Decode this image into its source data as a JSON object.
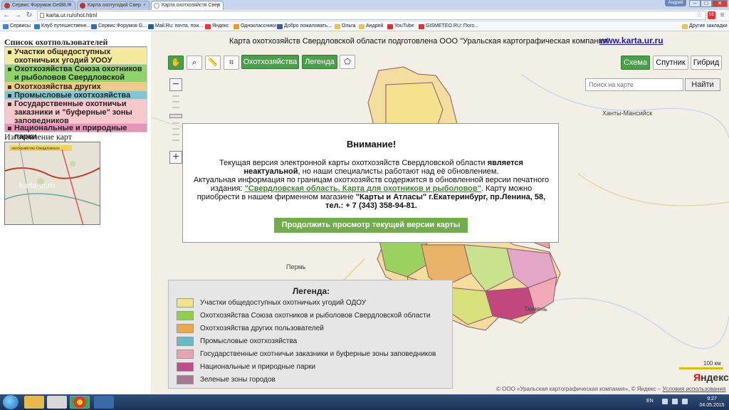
{
  "browser": {
    "tabs": [
      {
        "label": "Сервис Форумов Get88.R"
      },
      {
        "label": "Карта охотугодий Свер"
      },
      {
        "label": "Карта охотхозяйств Свер"
      }
    ],
    "user_badge": "Андрей",
    "url": "karta.ur.ru/ohot.html",
    "bookmarks": [
      {
        "label": "Сервисы",
        "color": "#4a7fd0"
      },
      {
        "label": "Клуб путешественн...",
        "color": "#2a7fd0"
      },
      {
        "label": "Сервис Форумов G...",
        "color": "#3a6ab0"
      },
      {
        "label": "Mail.Ru: почта, пои...",
        "color": "#1f5fa0"
      },
      {
        "label": "Яндекс",
        "color": "#e33"
      },
      {
        "label": "Одноклассники",
        "color": "#f7931e"
      },
      {
        "label": "Добро пожаловать...",
        "color": "#3b5998"
      },
      {
        "label": "Ольга",
        "color": "#e8c35a"
      },
      {
        "label": "Андрей",
        "color": "#e8c35a"
      },
      {
        "label": "YouTube",
        "color": "#e52d27"
      },
      {
        "label": "GISMETEO.RU: Пого...",
        "color": "#d33"
      }
    ],
    "other_bookmarks": "Другие закладки"
  },
  "sidebar": {
    "title": "Список охотпользователей",
    "categories": [
      {
        "label": "Участки общедоступных охотничьих угодий УООУ",
        "color": "#f4eb9e"
      },
      {
        "label": "Охотхозяйства Союза охотников и рыболовов Свердловской области",
        "color": "#8fd46a"
      },
      {
        "label": "Охотхозяйства других пользователей",
        "color": "#f3c987"
      },
      {
        "label": "Промысловые охотхозяйства",
        "color": "#7fc8d2"
      },
      {
        "label": "Государственные охотничьи заказники и \"буферные\" зоны заповедников",
        "color": "#f7c9cc"
      },
      {
        "label": "Национальные и природные парки",
        "color": "#e596b8"
      }
    ],
    "maps_title": "Изготовление карт",
    "thumb_banner": "охотхозяйство Свердловское",
    "thumb_watermark": "karta-ur.ru"
  },
  "map": {
    "header": "Карта охотхозяйств Свердловской области подготовлена ООО \"Уральская картографическая компания\"",
    "header_link": "www.karta.ur.ru",
    "tool_icons": [
      "hand-icon",
      "zoom-box-icon",
      "ruler-icon",
      "crop-icon"
    ],
    "btn_hunting": "Охотхозяйства",
    "btn_legend": "Легенда",
    "btn_scheme": "Схема",
    "btn_satellite": "Спутник",
    "btn_hybrid": "Гибрид",
    "search_placeholder": "Поиск на карте",
    "search_button": "Найти",
    "places": {
      "khanty": "Ханты-Мансийск",
      "perm": "Пермь",
      "tyumen": "Тюмень"
    },
    "scale_label": "100 км",
    "yandex_logo_first": "Я",
    "yandex_logo_rest": "ндекс",
    "copyright_text": "© ООО «Уральская картографическая компания», © Яндекс –",
    "copyright_link": "Условия использования"
  },
  "legend": {
    "title": "Легенда:",
    "items": [
      {
        "label": "Участки общедоступных охотничьих угодий ОДОУ",
        "color": "#efe38e"
      },
      {
        "label": "Охотхозяйства Союза охотников и рыболовов Свердловской области",
        "color": "#8fcf4a"
      },
      {
        "label": "Охотхозяйства других пользователей",
        "color": "#e9a94f"
      },
      {
        "label": "Промысловые охотхозяйства",
        "color": "#6ab8c6"
      },
      {
        "label": "Государственные охотничьи заказники и буферные зоны заповедников",
        "color": "#e4a6b2"
      },
      {
        "label": "Национальные и природные парки",
        "color": "#c04d8a"
      },
      {
        "label": "Зеленые зоны городов",
        "color": "#a7778f"
      }
    ]
  },
  "modal": {
    "title": "Внимание!",
    "line1": "Текущая версия электронной карты охотхозяйств Свердловской области ",
    "line1_bold": "является неактуальной",
    "line1_end": ", но наши специалисты работают над её обновлением.",
    "line2": "Актуальная информация по границам охотхозяйств содержится в обновленной версии печатного издания: ",
    "line2_link": "\"Свердловская область. Карта для охотников и рыболовов\"",
    "line2_mid": ". Карту можно приобрести в нашем фирменном магазине ",
    "line2_bold": "\"Карты и Атласы\" г.Екатеринбург, пр.Ленина, 58, тел.: + 7 (343) 358-94-81.",
    "button": "Продолжить просмотр текущей версии карты"
  },
  "taskbar": {
    "lang": "EN",
    "time": "9:27",
    "date": "04.05.2015"
  }
}
